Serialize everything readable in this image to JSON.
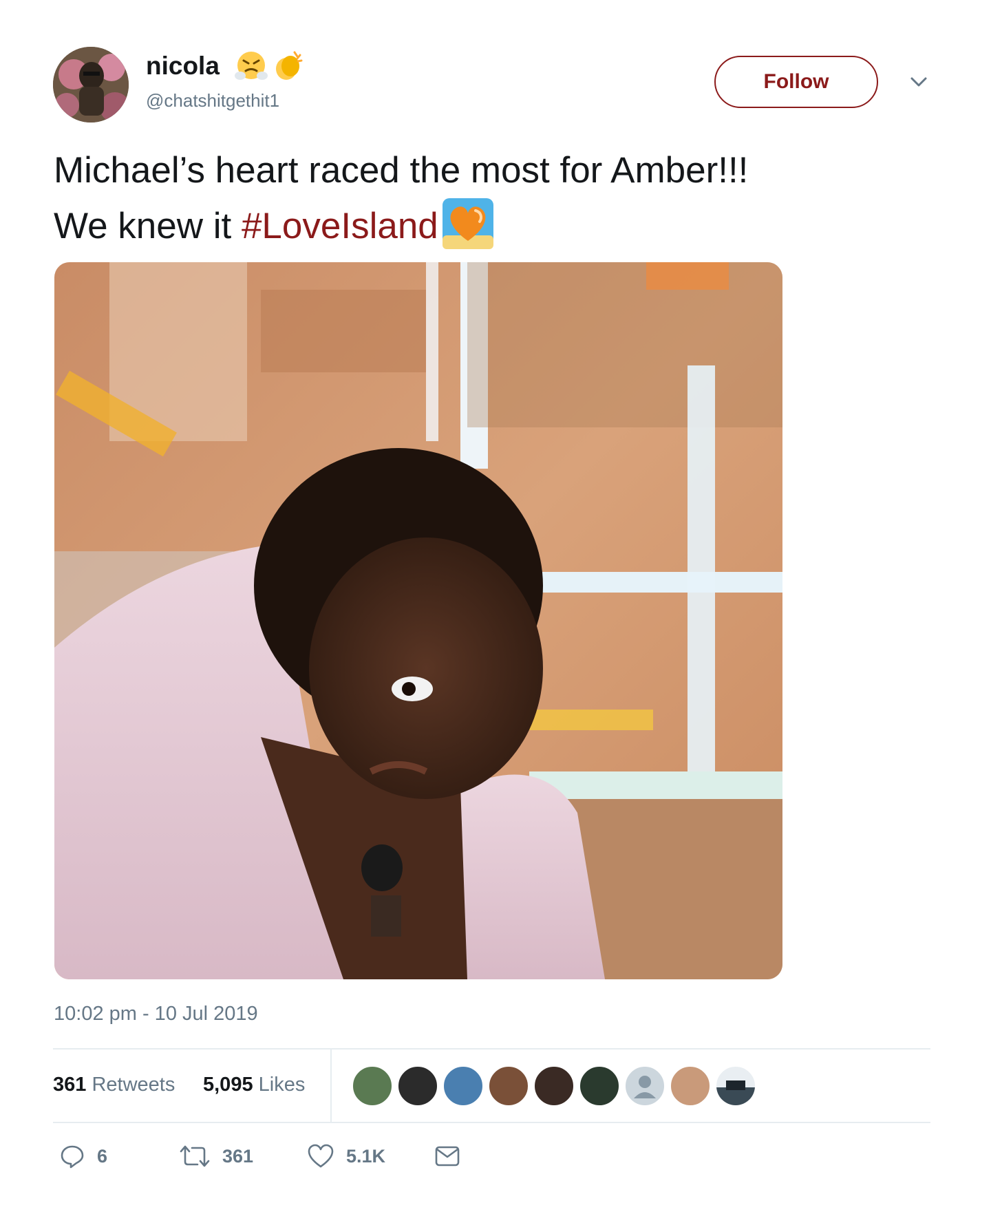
{
  "user": {
    "display_name": "nicola",
    "handle": "@chatshitgethit1",
    "name_emojis": [
      "face-with-steam-from-nose-icon",
      "clapping-hands-icon"
    ]
  },
  "follow_button": {
    "label": "Follow"
  },
  "tweet": {
    "line1": "Michael’s heart raced the most for Amber!!!",
    "line2_prefix": "We knew it ",
    "hashtag": "#LoveIsland",
    "hashtag_emoji": "love-island-orange-heart-icon"
  },
  "timestamp": "10:02 pm - 10 Jul 2019",
  "stats": {
    "retweets_count": "361",
    "retweets_label": "Retweets",
    "likes_count": "5,095",
    "likes_label": "Likes",
    "liker_avatar_count": 9
  },
  "actions": {
    "reply_count": "6",
    "retweet_count": "361",
    "like_count": "5.1K"
  },
  "colors": {
    "accent": "#8b1a1a",
    "secondary_text": "#657786",
    "divider": "#e6ecf0"
  }
}
